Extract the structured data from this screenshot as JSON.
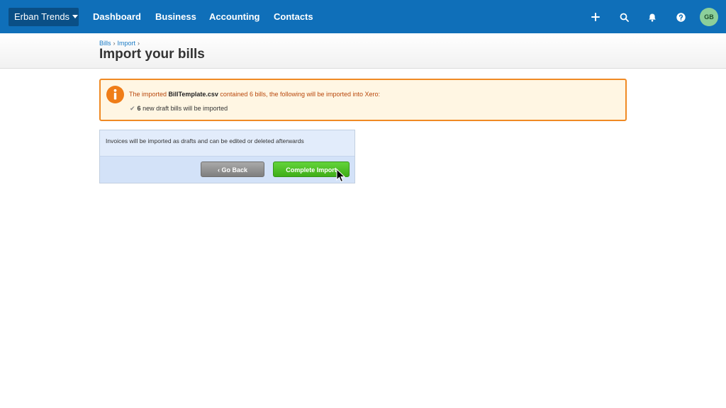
{
  "header": {
    "org_name": "Erban Trends",
    "nav": [
      "Dashboard",
      "Business",
      "Accounting",
      "Contacts"
    ],
    "icons": [
      "plus-icon",
      "search-icon",
      "bell-icon",
      "help-icon"
    ],
    "avatar_initials": "GB",
    "colors": {
      "bar": "#0f6fb9",
      "org": "#0a4f86",
      "avatar": "#8ccf9a"
    }
  },
  "breadcrumb": {
    "items": [
      "Bills",
      "Import"
    ],
    "separator": "›"
  },
  "page": {
    "title": "Import your bills"
  },
  "notice": {
    "prefix": "The imported ",
    "filename": "BillTemplate.csv",
    "suffix": " contained 6 bills, the following will be imported into Xero:",
    "count": "6",
    "detail": " new draft bills will be imported",
    "colors": {
      "border": "#f08a24",
      "background": "#fff6e3",
      "icon": "#ef7d18"
    }
  },
  "panel": {
    "message": "Invoices will be imported as drafts and can be edited or deleted afterwards",
    "back_label": "‹ Go Back",
    "complete_label": "Complete Import"
  }
}
